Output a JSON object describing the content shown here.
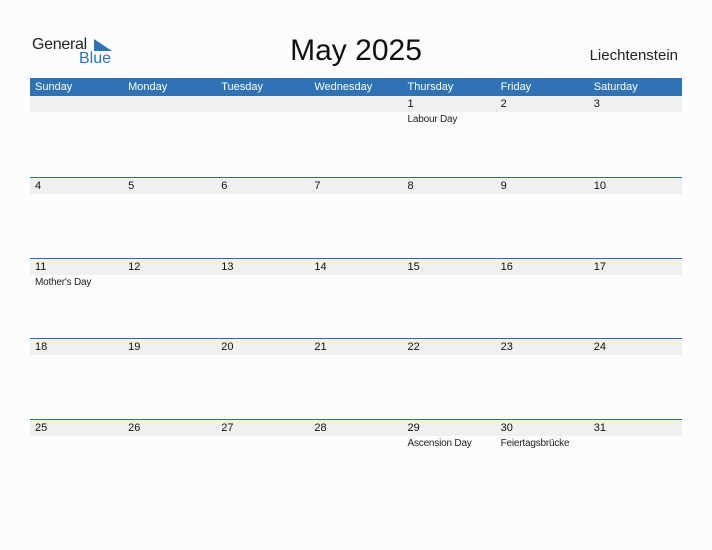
{
  "brand": {
    "general": "General",
    "blue": "Blue"
  },
  "title": "May 2025",
  "country": "Liechtenstein",
  "weekdays": [
    "Sunday",
    "Monday",
    "Tuesday",
    "Wednesday",
    "Thursday",
    "Friday",
    "Saturday"
  ],
  "weeks": [
    [
      {
        "day": "",
        "event": ""
      },
      {
        "day": "",
        "event": ""
      },
      {
        "day": "",
        "event": ""
      },
      {
        "day": "",
        "event": ""
      },
      {
        "day": "1",
        "event": "Labour Day"
      },
      {
        "day": "2",
        "event": ""
      },
      {
        "day": "3",
        "event": ""
      }
    ],
    [
      {
        "day": "4",
        "event": ""
      },
      {
        "day": "5",
        "event": ""
      },
      {
        "day": "6",
        "event": ""
      },
      {
        "day": "7",
        "event": ""
      },
      {
        "day": "8",
        "event": ""
      },
      {
        "day": "9",
        "event": ""
      },
      {
        "day": "10",
        "event": ""
      }
    ],
    [
      {
        "day": "11",
        "event": "Mother's Day"
      },
      {
        "day": "12",
        "event": ""
      },
      {
        "day": "13",
        "event": ""
      },
      {
        "day": "14",
        "event": ""
      },
      {
        "day": "15",
        "event": ""
      },
      {
        "day": "16",
        "event": ""
      },
      {
        "day": "17",
        "event": ""
      }
    ],
    [
      {
        "day": "18",
        "event": ""
      },
      {
        "day": "19",
        "event": ""
      },
      {
        "day": "20",
        "event": ""
      },
      {
        "day": "21",
        "event": ""
      },
      {
        "day": "22",
        "event": ""
      },
      {
        "day": "23",
        "event": ""
      },
      {
        "day": "24",
        "event": ""
      }
    ],
    [
      {
        "day": "25",
        "event": ""
      },
      {
        "day": "26",
        "event": ""
      },
      {
        "day": "27",
        "event": ""
      },
      {
        "day": "28",
        "event": ""
      },
      {
        "day": "29",
        "event": "Ascension Day"
      },
      {
        "day": "30",
        "event": "Feiertagsbrücke"
      },
      {
        "day": "31",
        "event": ""
      }
    ]
  ],
  "colors": {
    "header": "#2f73b5",
    "date_strip": "#f0f0f0",
    "week_border": "#2f6aa8"
  }
}
